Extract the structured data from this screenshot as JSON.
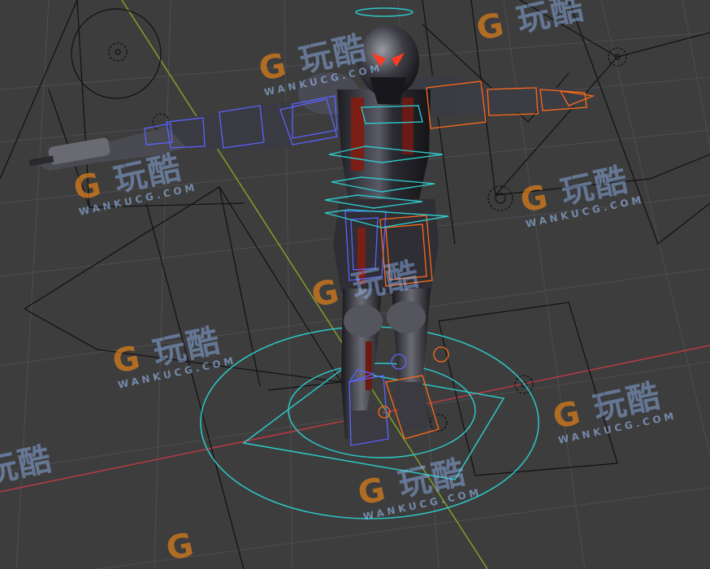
{
  "viewport": {
    "background": "#3d3d3d",
    "grid_color": "#4e4e4e",
    "x_axis_color": "#b83a44",
    "y_axis_color": "#7ea02c",
    "controller_cyan": "#2ec6c6",
    "controller_blue": "#5a63ff",
    "controller_orange": "#ff6a1a",
    "light_outline": "#111111"
  },
  "watermark": {
    "logo_mark": "G",
    "logo_text": "玩酷",
    "subtitle": "WANKUCG.COM"
  },
  "icons": {
    "light_empty": "light-empty-icon",
    "camera_outline": "camera-outline-icon"
  }
}
